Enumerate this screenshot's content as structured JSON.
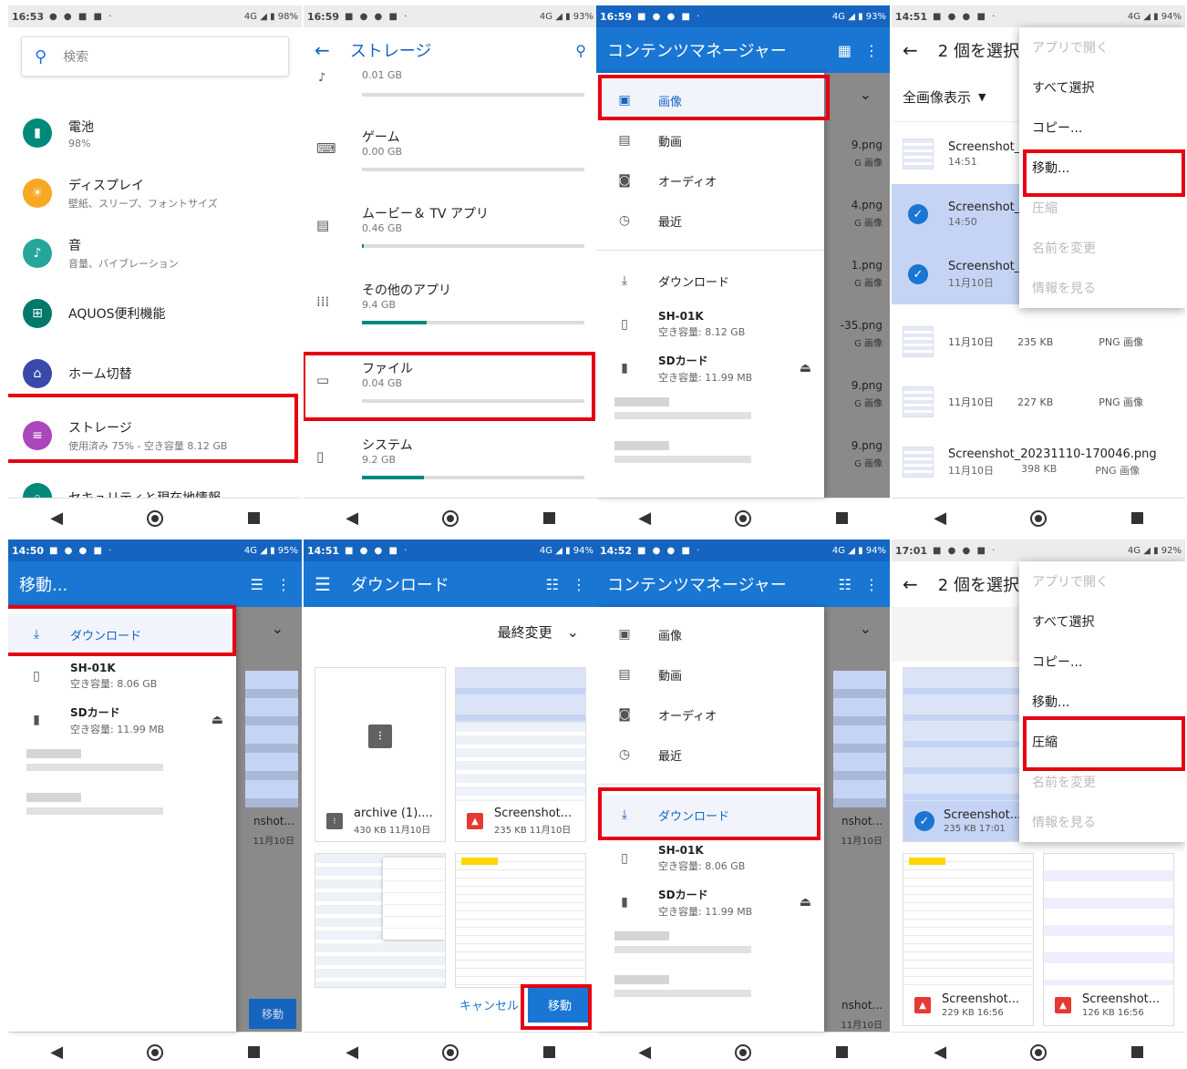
{
  "settings": {
    "status": {
      "time": "16:53",
      "right": "4G ◢ ▮ 98%"
    },
    "search_placeholder": "検索",
    "items": [
      {
        "title": "電池",
        "sub": "98%",
        "color": "#00897b",
        "icon": "battery-icon"
      },
      {
        "title": "ディスプレイ",
        "sub": "壁紙、スリープ、フォントサイズ",
        "color": "#f9a825",
        "icon": "brightness-icon"
      },
      {
        "title": "音",
        "sub": "音量、バイブレーション",
        "color": "#26a69a",
        "icon": "volume-icon"
      },
      {
        "title": "AQUOS便利機能",
        "sub": "",
        "color": "#00796b",
        "icon": "grid-icon"
      },
      {
        "title": "ホーム切替",
        "sub": "",
        "color": "#3949ab",
        "icon": "home-icon"
      },
      {
        "title": "ストレージ",
        "sub": "使用済み 75% - 空き容量 8.12 GB",
        "color": "#ab47bc",
        "icon": "storage-icon"
      },
      {
        "title": "セキュリティと現在地情報",
        "sub": "",
        "color": "#00897b",
        "icon": "lock-icon"
      }
    ]
  },
  "storage": {
    "status": {
      "time": "16:59",
      "right": "4G ◢ ▮ 93%"
    },
    "title": "ストレージ",
    "top_value": "0.01 GB",
    "items": [
      {
        "title": "ゲーム",
        "value": "0.00 GB",
        "fill": 0.0
      },
      {
        "title": "ムービー＆ TV アプリ",
        "value": "0.46 GB",
        "fill": 0.01
      },
      {
        "title": "その他のアプリ",
        "value": "9.4 GB",
        "fill": 0.29
      },
      {
        "title": "ファイル",
        "value": "0.04 GB",
        "fill": 0.0
      },
      {
        "title": "システム",
        "value": "9.2 GB",
        "fill": 0.28
      }
    ]
  },
  "content_manager": {
    "status": {
      "time": "16:59",
      "right": "4G ◢ ▮ 93%"
    },
    "title": "コンテンツマネージャー",
    "drawer": [
      "画像",
      "動画",
      "オーディオ",
      "最近"
    ],
    "download": "ダウンロード",
    "device": {
      "name": "SH-01K",
      "free": "空き容量: 8.12 GB"
    },
    "sd": {
      "name": "SDカード",
      "free": "空き容量: 11.99 MB"
    },
    "bg_files": [
      {
        "name": "9.png",
        "sub": "G 画像"
      },
      {
        "name": "4.png",
        "sub": "G 画像"
      },
      {
        "name": "1.png",
        "sub": "G 画像"
      },
      {
        "name": "-35.png",
        "sub": "G 画像"
      },
      {
        "name": "9.png",
        "sub": "G 画像"
      },
      {
        "name": "9.png",
        "sub": "G 画像"
      }
    ]
  },
  "selection": {
    "status": {
      "time": "14:51",
      "right": "4G ◢ ▮ 94%"
    },
    "title": "2 個を選択",
    "filter": "全画像表示",
    "menu": [
      {
        "label": "アプリで開く",
        "enabled": false
      },
      {
        "label": "すべて選択",
        "enabled": true
      },
      {
        "label": "コピー...",
        "enabled": true
      },
      {
        "label": "移動...",
        "enabled": true
      },
      {
        "label": "圧縮",
        "enabled": false
      },
      {
        "label": "名前を変更",
        "enabled": false
      },
      {
        "label": "情報を見る",
        "enabled": false
      }
    ],
    "rows": [
      {
        "name": "Screenshot_",
        "date": "14:51",
        "size": "",
        "type": "",
        "selected": false
      },
      {
        "name": "Screenshot_",
        "date": "14:50",
        "size": "",
        "type": "",
        "selected": true
      },
      {
        "name": "Screenshot_",
        "date": "11月10日",
        "size": "",
        "type": "",
        "selected": true
      },
      {
        "name": "",
        "date": "11月10日",
        "size": "235 KB",
        "type": "PNG 画像",
        "selected": false
      },
      {
        "name": "",
        "date": "11月10日",
        "size": "227 KB",
        "type": "PNG 画像",
        "selected": false
      },
      {
        "name": "Screenshot_20231110-170046.png",
        "date": "11月10日",
        "size": "398 KB",
        "type": "PNG 画像",
        "selected": false
      }
    ]
  },
  "move": {
    "status": {
      "time": "14:50",
      "right": "4G ◢ ▮ 95%"
    },
    "title": "移動...",
    "download": "ダウンロード",
    "device": {
      "name": "SH-01K",
      "free": "空き容量: 8.06 GB"
    },
    "sd": {
      "name": "SDカード",
      "free": "空き容量: 11.99 MB"
    },
    "bg_button": "移動",
    "bg_name": "nshot...",
    "bg_date": "11月10日"
  },
  "download_view": {
    "status": {
      "time": "14:51",
      "right": "4G ◢ ▮ 94%"
    },
    "title": "ダウンロード",
    "sort": "最終変更",
    "cards": [
      {
        "name": "archive (1)....",
        "meta": "430 KB 11月10日"
      },
      {
        "name": "Screenshot...",
        "meta": "235 KB 11月10日"
      }
    ],
    "cancel": "キャンセル",
    "move": "移動"
  },
  "content_manager2": {
    "status": {
      "time": "14:52",
      "right": "4G ◢ ▮ 94%"
    },
    "title": "コンテンツマネージャー",
    "drawer": [
      "画像",
      "動画",
      "オーディオ",
      "最近"
    ],
    "download": "ダウンロード",
    "device": {
      "name": "SH-01K",
      "free": "空き容量: 8.06 GB"
    },
    "sd": {
      "name": "SDカード",
      "free": "空き容量: 11.99 MB"
    },
    "bg_name": "nshot...",
    "bg_date": "11月10日",
    "bg_name2": "nshot...",
    "bg_date2": "11月10日"
  },
  "compress": {
    "status": {
      "time": "17:01",
      "right": "4G ◢ ▮ 92%"
    },
    "title": "2 個を選択",
    "menu": [
      {
        "label": "アプリで開く",
        "enabled": false
      },
      {
        "label": "すべて選択",
        "enabled": true
      },
      {
        "label": "コピー...",
        "enabled": true
      },
      {
        "label": "移動...",
        "enabled": true
      },
      {
        "label": "圧縮",
        "enabled": true
      },
      {
        "label": "名前を変更",
        "enabled": false
      },
      {
        "label": "情報を見る",
        "enabled": false
      }
    ],
    "card_sel": {
      "name": "Screenshot...",
      "meta": "235 KB 17:01"
    },
    "cards": [
      {
        "name": "Screenshot...",
        "meta": "229 KB 16:56"
      },
      {
        "name": "Screenshot...",
        "meta": "126 KB 16:56"
      }
    ]
  },
  "colors": {
    "accent": "#1976d2",
    "highlight": "#e60012"
  }
}
